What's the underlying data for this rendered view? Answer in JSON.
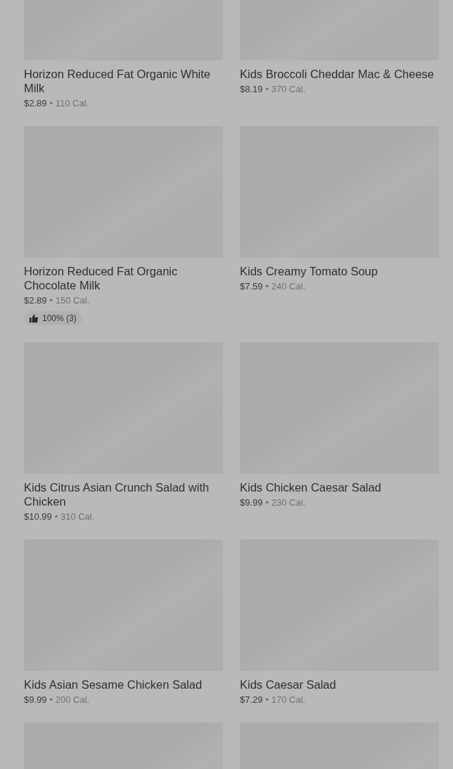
{
  "items": [
    {
      "name": "Horizon Reduced Fat Organic White Milk",
      "price": "$2.89",
      "calories": "• 110 Cal."
    },
    {
      "name": "Kids Broccoli Cheddar Mac & Cheese",
      "price": "$8.19",
      "calories": "• 370 Cal."
    },
    {
      "name": "Horizon Reduced Fat Organic Chocolate Milk",
      "price": "$2.89",
      "calories": "• 150 Cal.",
      "rating": "100% (3)"
    },
    {
      "name": "Kids Creamy Tomato Soup",
      "price": "$7.59",
      "calories": "• 240 Cal."
    },
    {
      "name": "Kids Citrus Asian Crunch Salad with Chicken",
      "price": "$10.99",
      "calories": "• 310 Cal."
    },
    {
      "name": "Kids Chicken Caesar Salad",
      "price": "$9.99",
      "calories": "• 230 Cal."
    },
    {
      "name": "Kids Asian Sesame Chicken Salad",
      "price": "$9.99",
      "calories": "• 200 Cal."
    },
    {
      "name": "Kids Caesar Salad",
      "price": "$7.29",
      "calories": "• 170 Cal."
    },
    {
      "image": {
        "kind": "picture"
      }
    },
    {
      "image": {
        "kind": "picture"
      }
    }
  ]
}
